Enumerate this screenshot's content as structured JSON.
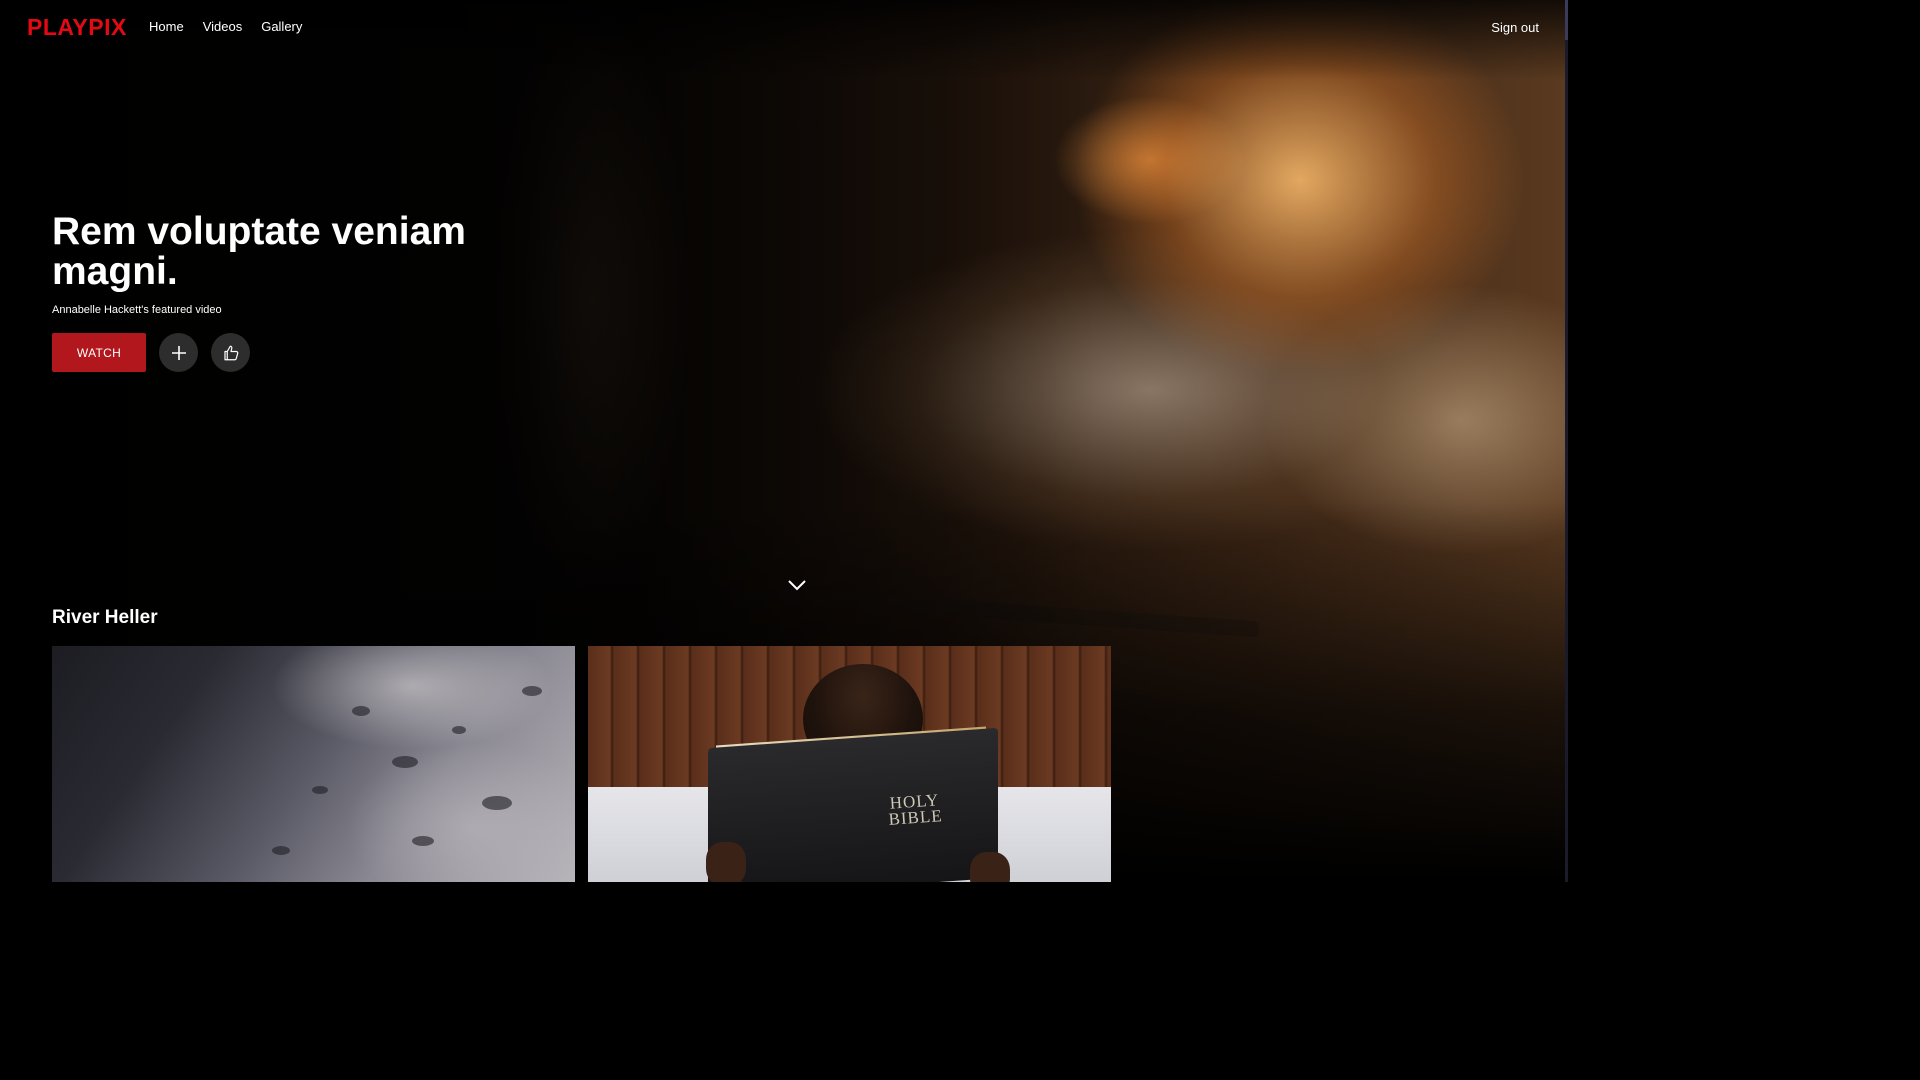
{
  "app": {
    "logo": "PLAYPIX"
  },
  "nav": {
    "items": [
      "Home",
      "Videos",
      "Gallery"
    ],
    "sign_out": "Sign out"
  },
  "hero": {
    "title": "Rem voluptate veniam magni.",
    "subtitle": "Annabelle Hackett's featured video",
    "watch_label": "WATCH",
    "add_icon": "plus-icon",
    "like_icon": "thumbs-up-icon",
    "scroll_icon": "chevron-down-icon"
  },
  "row": {
    "title": "River Heller",
    "items": [
      {
        "image": "water-droplets-thumbnail"
      },
      {
        "image": "child-reading-bible-thumbnail",
        "book_text_line1": "HOLY",
        "book_text_line2": "BIBLE"
      }
    ]
  },
  "colors": {
    "brand": "#e50914",
    "watch_button": "#b1171c",
    "background": "#000000"
  }
}
